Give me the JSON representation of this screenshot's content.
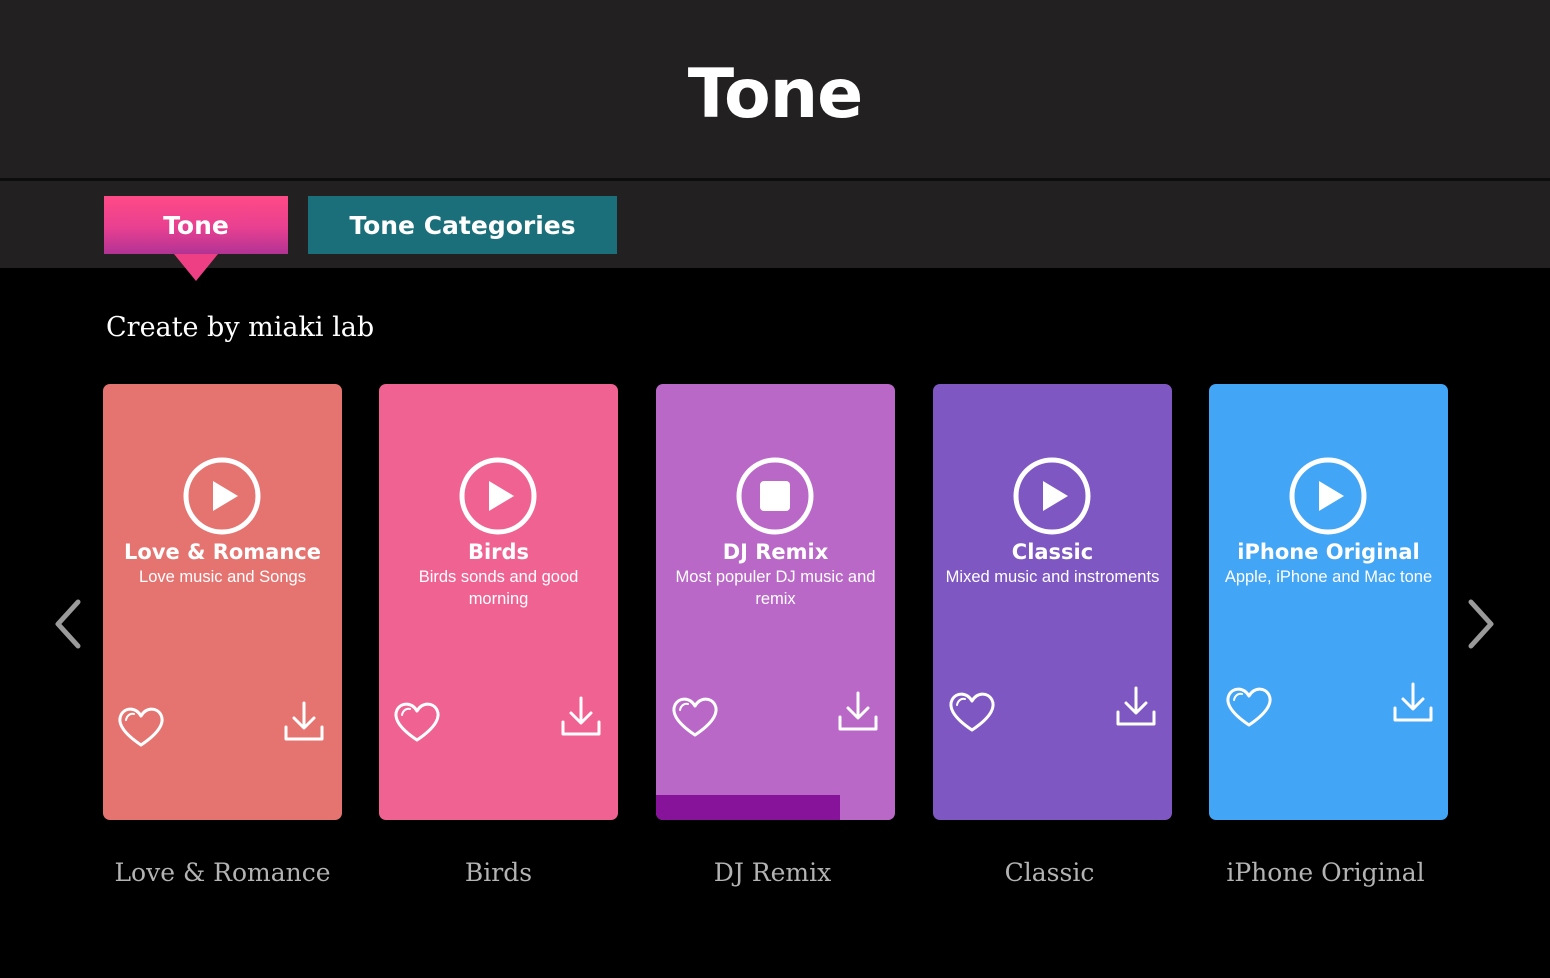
{
  "app": {
    "title": "Tone"
  },
  "tabs": [
    {
      "label": "Tone",
      "active": true
    },
    {
      "label": "Tone Categories",
      "active": false
    }
  ],
  "subtitle": "Create by miaki lab",
  "colors": {
    "header_bg": "#222021",
    "tab_active": "#ee3f85",
    "tab_inactive": "#1b6f7a",
    "progress": "#86139a"
  },
  "cards": [
    {
      "title": "Love & Romance",
      "description": "Love music and Songs",
      "label": "Love & Romance",
      "color": "#e57471",
      "state": "play-icon",
      "favorite_icon": "heart-icon",
      "download_icon": "download-icon"
    },
    {
      "title": "Birds",
      "description": "Birds sonds and good morning",
      "label": "Birds",
      "color": "#f06292",
      "state": "play-icon",
      "favorite_icon": "heart-icon",
      "download_icon": "download-icon"
    },
    {
      "title": "DJ Remix",
      "description": "Most populer DJ music and remix",
      "label": "DJ Remix",
      "color": "#ba68c8",
      "state": "stop-icon",
      "progress": 0.77,
      "favorite_icon": "heart-icon",
      "download_icon": "download-icon"
    },
    {
      "title": "Classic",
      "description": "Mixed music and instroments",
      "label": "Classic",
      "color": "#7e57c2",
      "state": "play-icon",
      "favorite_icon": "heart-icon",
      "download_icon": "download-icon"
    },
    {
      "title": "iPhone Original",
      "description": "Apple, iPhone and Mac tone",
      "label": "iPhone Original",
      "color": "#42a5f5",
      "state": "play-icon",
      "favorite_icon": "heart-icon",
      "download_icon": "download-icon"
    }
  ]
}
